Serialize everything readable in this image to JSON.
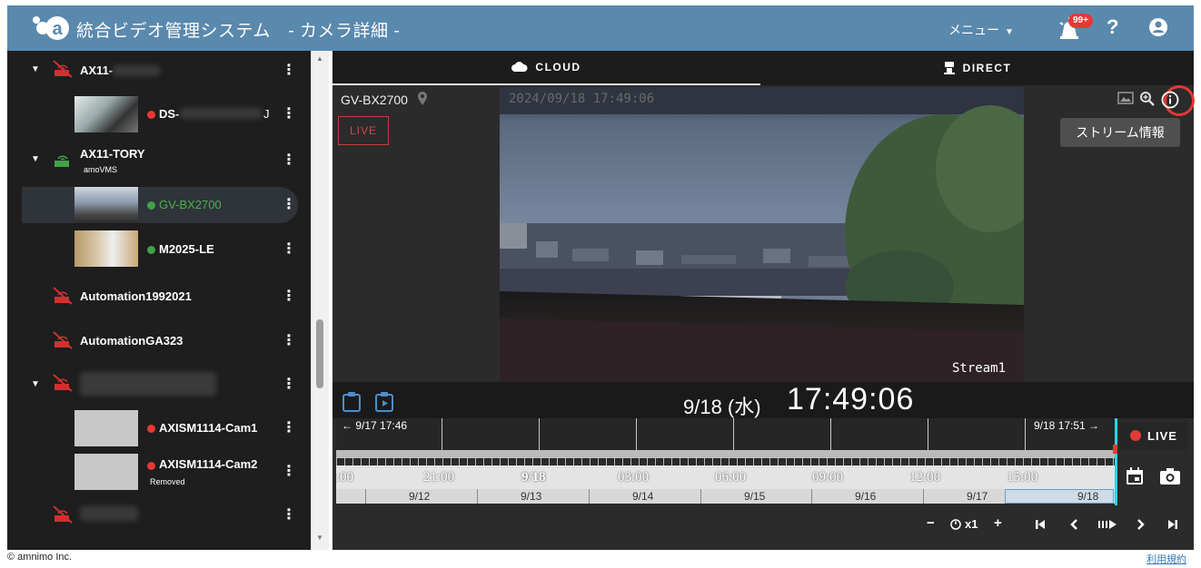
{
  "header": {
    "title": "統合ビデオ管理システム　- カメラ詳細 -",
    "menu_label": "メニュー",
    "notification_badge": "99+",
    "help_label": "?",
    "brand_color": "#5a89ae"
  },
  "sidebar": {
    "items": [
      {
        "name": "AX11-",
        "type": "router-offline"
      },
      {
        "name": "DS-",
        "suffix": "J",
        "type": "camera",
        "status": "red"
      },
      {
        "name": "AX11-TORY",
        "sub": "amoVMS",
        "type": "router-online"
      },
      {
        "name": "GV-BX2700",
        "type": "camera",
        "status": "green",
        "selected": true
      },
      {
        "name": "M2025-LE",
        "type": "camera",
        "status": "green"
      },
      {
        "name": "Automation1992021",
        "type": "router-offline"
      },
      {
        "name": "AutomationGA323",
        "type": "router-offline"
      },
      {
        "name": "",
        "type": "router-offline"
      },
      {
        "name": "AXISM1114-Cam1",
        "type": "camera",
        "status": "red"
      },
      {
        "name": "AXISM1114-Cam2",
        "sub": "Removed",
        "type": "camera",
        "status": "red"
      },
      {
        "name": "",
        "type": "router-offline"
      }
    ],
    "kebab": "⋮"
  },
  "footer": {
    "copyright": "© amnimo Inc.",
    "terms": "利用規約"
  },
  "tabs": [
    {
      "label": "CLOUD",
      "icon": "cloud-icon",
      "active": true
    },
    {
      "label": "DIRECT",
      "icon": "camera-icon",
      "active": false
    }
  ],
  "viewer": {
    "camera_name": "GV-BX2700",
    "live_badge": "LIVE",
    "timestamp": "2024/09/18 17:49:06",
    "stream_label": "Stream1",
    "stream_info_button": "ストリーム情報"
  },
  "playback": {
    "date": "9/18 (水)",
    "time": "17:49:06",
    "range_start": "← 9/17 17:46",
    "range_end": "9/18 17:51 →",
    "live_button": "LIVE",
    "hours": [
      ":00",
      "21:00",
      "9/18",
      "03:00",
      "06:00",
      "09:00",
      "12:00",
      "15:00"
    ],
    "days": [
      "9/12",
      "9/13",
      "9/14",
      "9/15",
      "9/16",
      "9/17",
      "9/18"
    ],
    "speed": "x1",
    "minus": "−",
    "plus": "+"
  }
}
